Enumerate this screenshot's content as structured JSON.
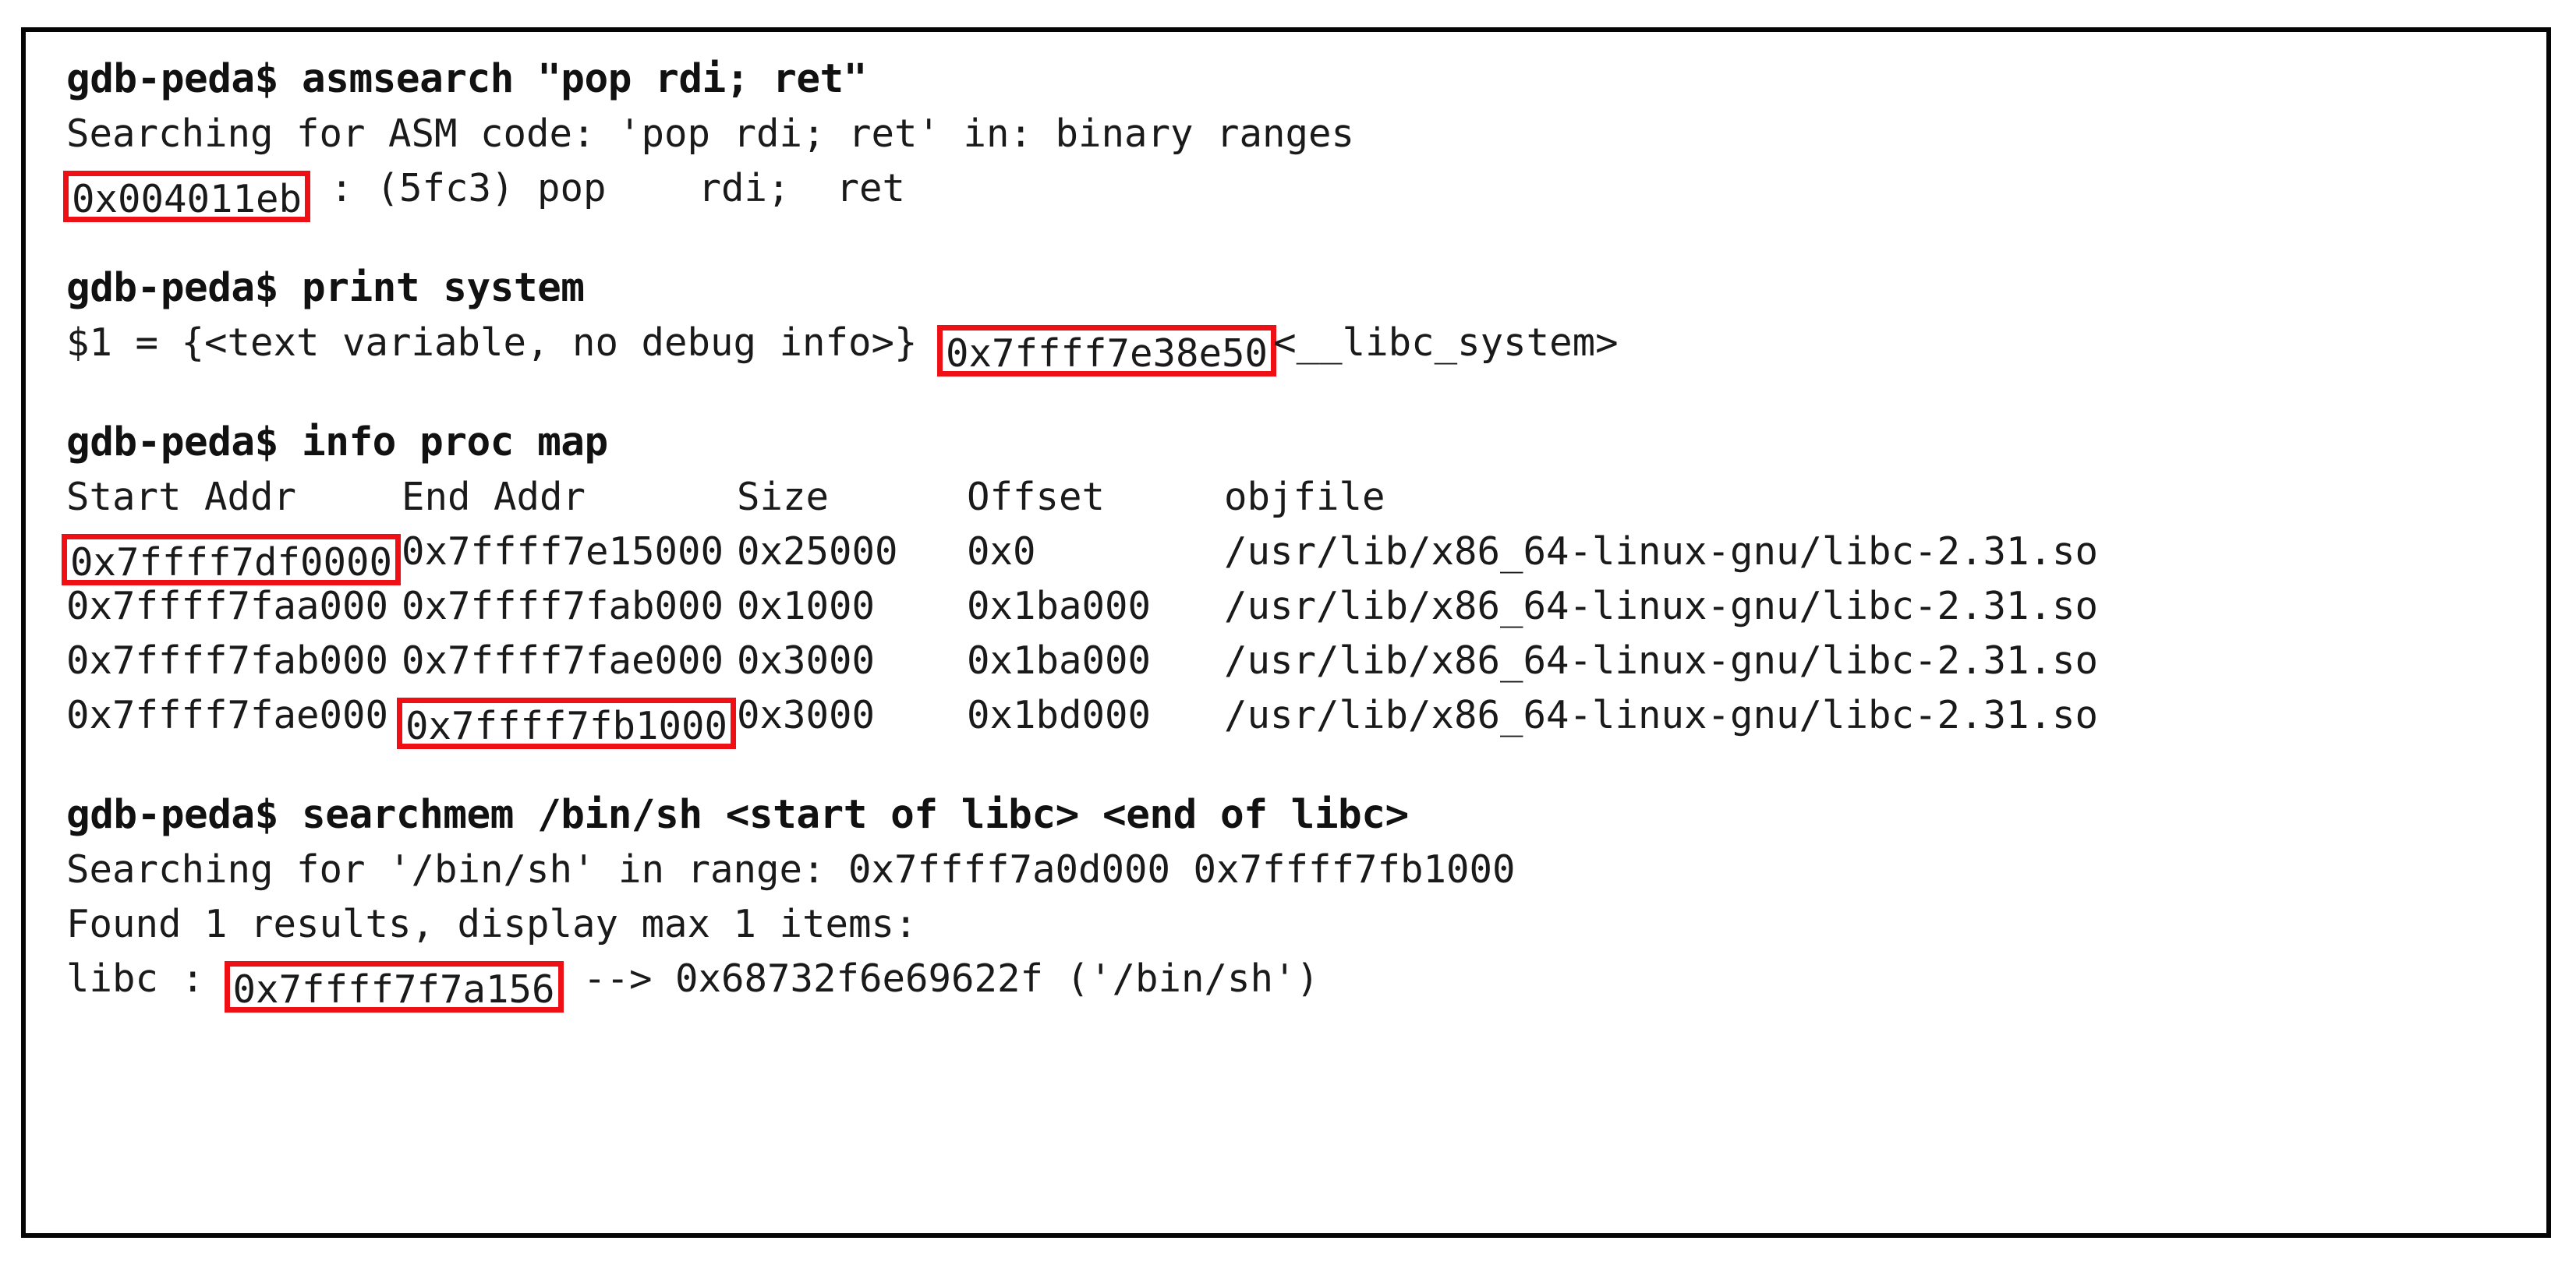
{
  "terminal": {
    "prompt": "gdb-peda$",
    "accent_highlight_color": "#ee1014",
    "frame_border_color": "#050505",
    "text_color": "#111111",
    "background_color": "#ffffff",
    "blocks": [
      {
        "command": "gdb-peda$ asmsearch \"pop rdi; ret\"",
        "output": [
          "Searching for ASM code: 'pop rdi; ret' in: binary ranges"
        ]
      },
      {
        "command": "gdb-peda$ print system",
        "output": []
      },
      {
        "command": "gdb-peda$ info proc map",
        "output": []
      },
      {
        "command": "gdb-peda$ searchmem /bin/sh <start of libc> <end of libc>",
        "output": []
      }
    ]
  },
  "asmsearch": {
    "command": "gdb-peda$ asmsearch \"pop rdi; ret\"",
    "search_line": "Searching for ASM code: 'pop rdi; ret' in: binary ranges",
    "result_address": "0x004011eb",
    "result_rest": " : (5fc3) pop    rdi;  ret"
  },
  "print_system": {
    "command": "gdb-peda$ print system",
    "result_prefix": "$1 = {<text variable, no debug info>}",
    "result_address": "0x7ffff7e38e50",
    "result_suffix": "<__libc_system>"
  },
  "info_proc_map": {
    "command": "gdb-peda$ info proc map",
    "headers": {
      "start": "Start Addr",
      "end": "End Addr",
      "size": "Size",
      "offset": "Offset",
      "objfile": "objfile"
    },
    "rows": [
      {
        "start": "0x7ffff7df0000",
        "end": "0x7ffff7e15000",
        "size": "0x25000",
        "offset": "0x0",
        "objfile": "/usr/lib/x86_64-linux-gnu/libc-2.31.so",
        "start_highlighted": true,
        "end_highlighted": false
      },
      {
        "start": "0x7ffff7faa000",
        "end": "0x7ffff7fab000",
        "size": "0x1000",
        "offset": "0x1ba000",
        "objfile": "/usr/lib/x86_64-linux-gnu/libc-2.31.so",
        "start_highlighted": false,
        "end_highlighted": false
      },
      {
        "start": "0x7ffff7fab000",
        "end": "0x7ffff7fae000",
        "size": "0x3000",
        "offset": "0x1ba000",
        "objfile": "/usr/lib/x86_64-linux-gnu/libc-2.31.so",
        "start_highlighted": false,
        "end_highlighted": false
      },
      {
        "start": "0x7ffff7fae000",
        "end": "0x7ffff7fb1000",
        "size": "0x3000",
        "offset": "0x1bd000",
        "objfile": "/usr/lib/x86_64-linux-gnu/libc-2.31.so",
        "start_highlighted": false,
        "end_highlighted": true
      }
    ]
  },
  "searchmem": {
    "command": "gdb-peda$ searchmem /bin/sh <start of libc> <end of libc>",
    "search_line": "Searching for '/bin/sh' in range: 0x7ffff7a0d000 0x7ffff7fb1000",
    "found_line": "Found 1 results, display max 1 items:",
    "result_prefix": "libc : ",
    "result_address": "0x7ffff7f7a156",
    "result_suffix": " --> 0x68732f6e69622f ('/bin/sh')"
  }
}
